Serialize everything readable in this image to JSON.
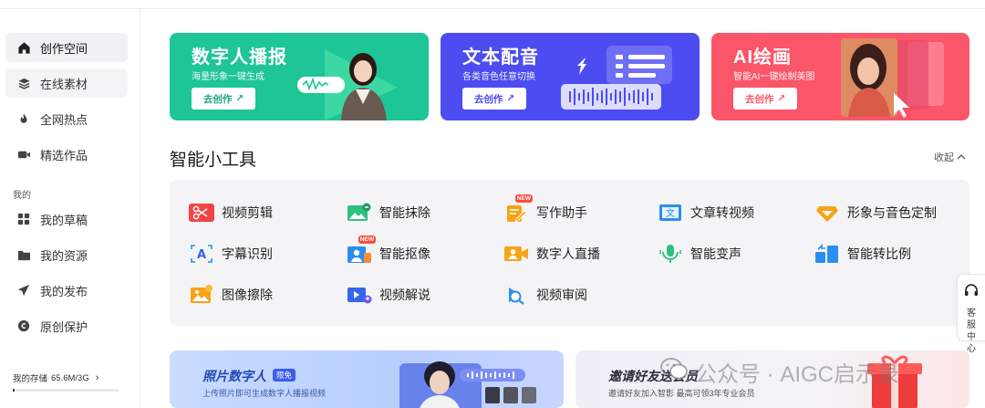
{
  "sidebar": {
    "items": [
      {
        "label": "创作空间",
        "icon": "home-icon"
      },
      {
        "label": "在线素材",
        "icon": "layers-icon"
      },
      {
        "label": "全网热点",
        "icon": "flame-icon"
      },
      {
        "label": "精选作品",
        "icon": "video-camera-icon"
      }
    ],
    "section_mine": "我的",
    "mine_items": [
      {
        "label": "我的草稿",
        "icon": "grid-icon"
      },
      {
        "label": "我的资源",
        "icon": "folder-icon"
      },
      {
        "label": "我的发布",
        "icon": "send-icon"
      },
      {
        "label": "原创保护",
        "icon": "copyright-icon"
      }
    ],
    "storage_label": "我的存储",
    "storage_value": "65.6M/3G",
    "storage_fraction": 0.02
  },
  "banners": [
    {
      "title": "数字人播报",
      "subtitle": "海量形象一键生成",
      "cta": "去创作",
      "color": "#1dc594"
    },
    {
      "title": "文本配音",
      "subtitle": "各类音色任意切换",
      "cta": "去创作",
      "color": "#4b4cf0"
    },
    {
      "title": "AI绘画",
      "subtitle": "智能AI一键绘制美图",
      "cta": "去创作",
      "color": "#fb5468"
    }
  ],
  "tools": {
    "title": "智能小工具",
    "collapse_label": "收起",
    "new_badge": "NEW",
    "items": [
      {
        "label": "视频剪辑",
        "icon": "scissors-icon"
      },
      {
        "label": "智能抹除",
        "icon": "image-erase-icon"
      },
      {
        "label": "写作助手",
        "icon": "pen-icon"
      },
      {
        "label": "文章转视频",
        "icon": "text-to-video-icon",
        "glyph": "文"
      },
      {
        "label": "形象与音色定制",
        "icon": "diamond-icon"
      },
      {
        "label": "字幕识别",
        "icon": "subtitle-icon",
        "glyph": "A"
      },
      {
        "label": "智能抠像",
        "icon": "portrait-cutout-icon"
      },
      {
        "label": "数字人直播",
        "icon": "live-stream-icon"
      },
      {
        "label": "智能变声",
        "icon": "microphone-icon"
      },
      {
        "label": "智能转比例",
        "icon": "aspect-ratio-icon"
      },
      {
        "label": "图像擦除",
        "icon": "image-icon"
      },
      {
        "label": "视频解说",
        "icon": "video-narration-icon"
      },
      {
        "label": "视频审阅",
        "icon": "video-review-icon"
      }
    ]
  },
  "cards": [
    {
      "title": "照片数字人",
      "tag": "限免",
      "subtitle": "上传照片即可生成数字人播报视频"
    },
    {
      "title": "邀请好友送会员",
      "subtitle": "邀请好友加入智影 最高可领3年专业会员"
    }
  ],
  "float": {
    "label": "客服中心",
    "icon": "headset-icon"
  },
  "watermark": "公众号 · AIGC启示录"
}
